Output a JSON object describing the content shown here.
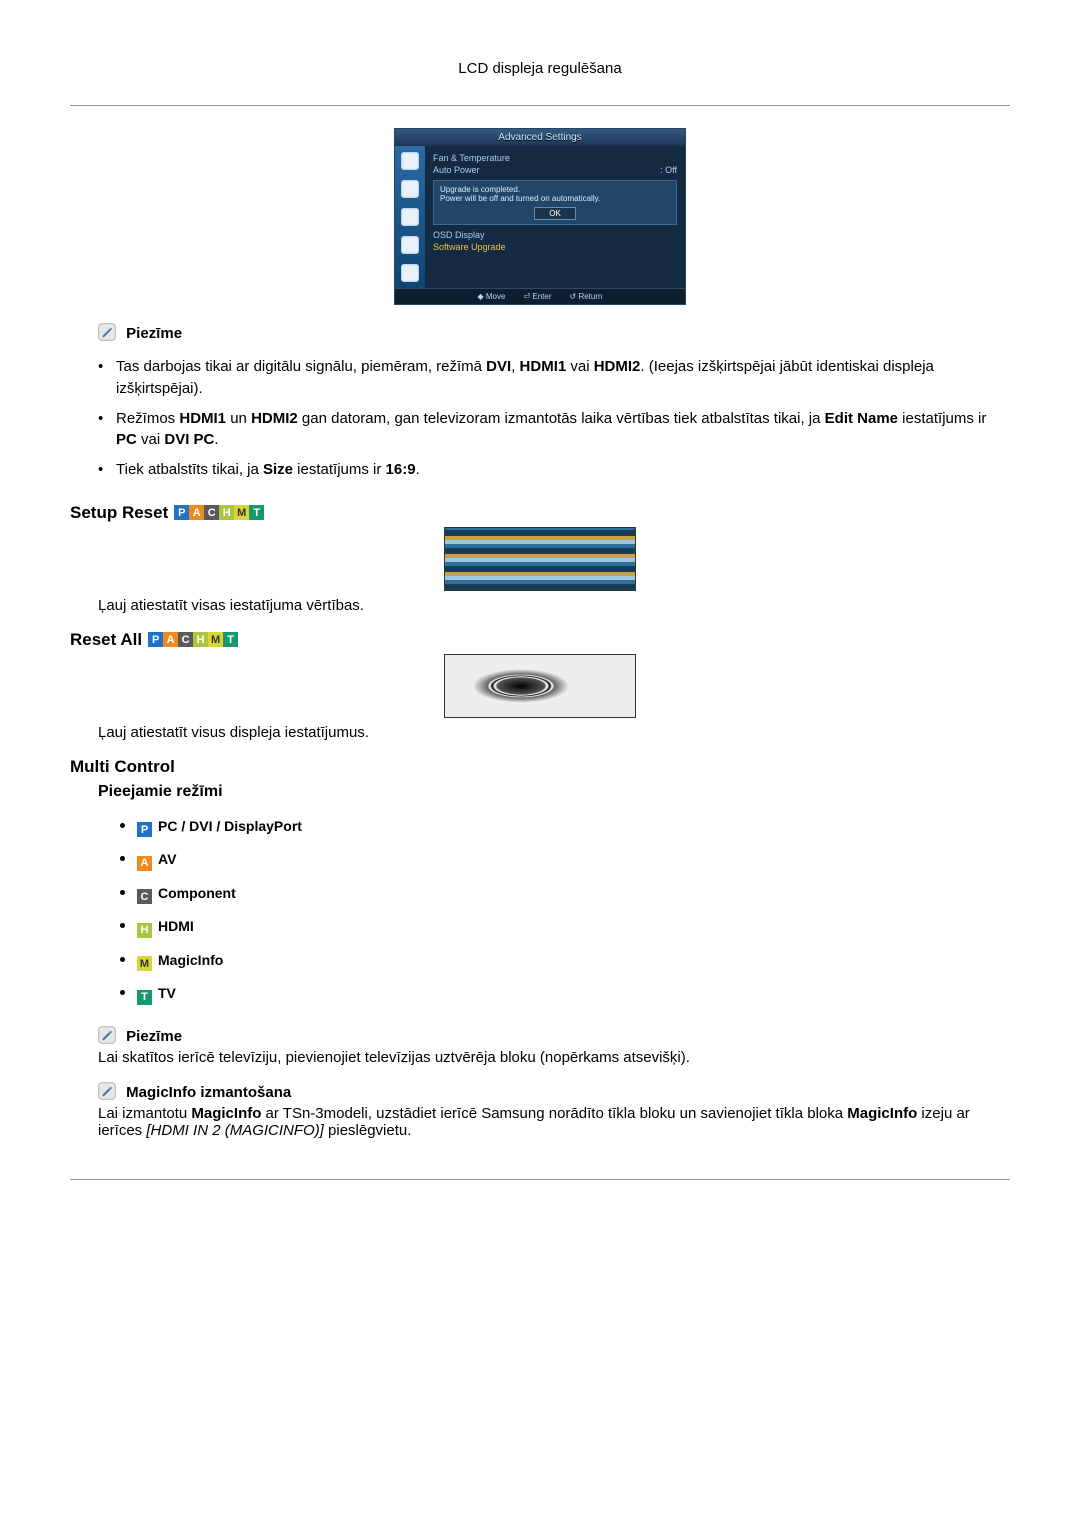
{
  "header": "LCD displeja regulēšana",
  "osd": {
    "title": "Advanced Settings",
    "row1": "Fan & Temperature",
    "row2_label": "Auto Power",
    "row2_value": ": Off",
    "popup_l1": "Upgrade is completed.",
    "popup_l2": "Power will be off and turned on automatically.",
    "popup_ok": "OK",
    "row3": "OSD Display",
    "row4": "Software Upgrade",
    "foot_move": "Move",
    "foot_enter": "Enter",
    "foot_return": "Return"
  },
  "note1_label": "Piezīme",
  "note1_items": [
    "Tas darbojas tikai ar digitālu signālu, piemēram, režīmā DVI, HDMI1 vai HDMI2. (Ieejas izšķirtspējai jābūt identiskai displeja izšķirtspējai).",
    "Režīmos HDMI1 un HDMI2 gan datoram, gan televizoram izmantotās laika vērtības tiek atbalstītas tikai, ja Edit Name iestatījums ir PC vai DVI PC.",
    "Tiek atbalstīts tikai, ja Size iestatījums ir 16:9."
  ],
  "setup_reset": {
    "title": "Setup Reset",
    "body": "Ļauj atiestatīt visas iestatījuma vērtības."
  },
  "reset_all": {
    "title": "Reset All",
    "body": "Ļauj atiestatīt visus displeja iestatījumus."
  },
  "multi_control": {
    "title": "Multi Control",
    "sub": "Pieejamie režīmi",
    "modes": [
      {
        "badge": "P",
        "label": "PC / DVI / DisplayPort"
      },
      {
        "badge": "A",
        "label": "AV"
      },
      {
        "badge": "C",
        "label": "Component"
      },
      {
        "badge": "H",
        "label": "HDMI"
      },
      {
        "badge": "M",
        "label": "MagicInfo"
      },
      {
        "badge": "T",
        "label": "TV"
      }
    ]
  },
  "note2_label": "Piezīme",
  "note2_body": "Lai skatītos ierīcē televīziju, pievienojiet televīzijas uztvērēja bloku (nopērkams atsevišķi).",
  "magicinfo_label": "MagicInfo izmantošana",
  "magicinfo_body_a": "Lai izmantotu ",
  "magicinfo_body_b": "MagicInfo",
  "magicinfo_body_c": " ar TSn-3modeli, uzstādiet ierīcē Samsung norādīto tīkla bloku un savienojiet tīkla bloka ",
  "magicinfo_body_d": "MagicInfo",
  "magicinfo_body_e": " izeju ar ierīces ",
  "magicinfo_body_f": "[HDMI IN 2 (MAGICINFO)]",
  "magicinfo_body_g": " pieslēgvietu."
}
